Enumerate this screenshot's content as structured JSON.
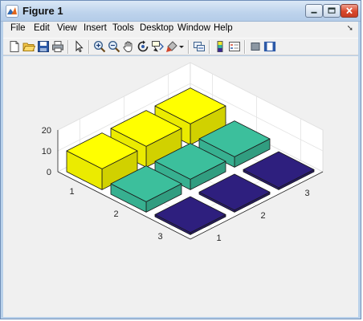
{
  "window": {
    "title": "Figure 1"
  },
  "menu": {
    "items": [
      "File",
      "Edit",
      "View",
      "Insert",
      "Tools",
      "Desktop",
      "Window",
      "Help"
    ]
  },
  "toolbar": {
    "icons": [
      "new-figure-icon",
      "open-file-icon",
      "save-icon",
      "print-icon",
      "edit-plot-arrow-icon",
      "zoom-in-icon",
      "zoom-out-icon",
      "pan-hand-icon",
      "rotate-3d-icon",
      "data-cursor-icon",
      "brush-icon",
      "brush-dropdown-icon",
      "link-plot-icon",
      "insert-colorbar-icon",
      "insert-legend-icon",
      "hide-plot-tools-icon",
      "show-plot-tools-icon"
    ]
  },
  "chart_data": {
    "type": "bar3",
    "rows": [
      "1",
      "2",
      "3"
    ],
    "columns": [
      "1",
      "2",
      "3"
    ],
    "values": [
      [
        10,
        10,
        10
      ],
      [
        5,
        5,
        5
      ],
      [
        1,
        1,
        1
      ]
    ],
    "row_colors": [
      "#ffff00",
      "#3cbf9c",
      "#2e1f7e"
    ],
    "z_ticks": [
      "0",
      "10",
      "20"
    ],
    "zlim": [
      0,
      20
    ],
    "grid": true
  }
}
